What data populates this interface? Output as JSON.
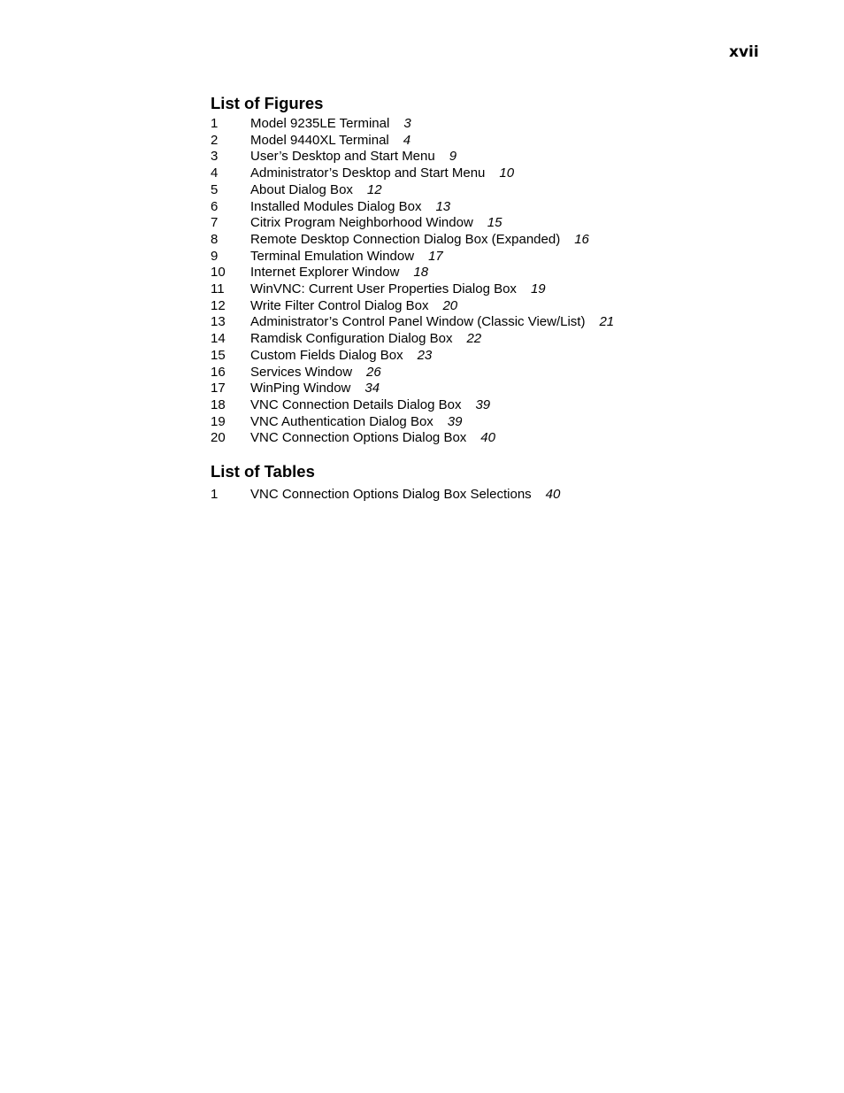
{
  "page": {
    "number": "xvii"
  },
  "figures": {
    "heading": "List of Figures",
    "items": [
      {
        "num": "1",
        "title": "Model 9235LE Terminal",
        "page": "3"
      },
      {
        "num": "2",
        "title": "Model 9440XL Terminal",
        "page": "4"
      },
      {
        "num": "3",
        "title": "User’s Desktop and Start Menu",
        "page": "9"
      },
      {
        "num": "4",
        "title": "Administrator’s Desktop and Start Menu",
        "page": "10"
      },
      {
        "num": "5",
        "title": "About Dialog Box",
        "page": "12"
      },
      {
        "num": "6",
        "title": "Installed Modules Dialog Box",
        "page": "13"
      },
      {
        "num": "7",
        "title": "Citrix Program Neighborhood Window",
        "page": "15"
      },
      {
        "num": "8",
        "title": "Remote Desktop Connection Dialog Box (Expanded)",
        "page": "16"
      },
      {
        "num": "9",
        "title": "Terminal Emulation Window",
        "page": "17"
      },
      {
        "num": "10",
        "title": "Internet Explorer Window",
        "page": "18"
      },
      {
        "num": "11",
        "title": "WinVNC: Current User Properties Dialog Box",
        "page": "19"
      },
      {
        "num": "12",
        "title": "Write Filter Control Dialog Box",
        "page": "20"
      },
      {
        "num": "13",
        "title": "Administrator’s Control Panel Window (Classic View/List)",
        "page": "21"
      },
      {
        "num": "14",
        "title": "Ramdisk Configuration Dialog Box",
        "page": "22"
      },
      {
        "num": "15",
        "title": "Custom Fields Dialog Box",
        "page": "23"
      },
      {
        "num": "16",
        "title": "Services Window",
        "page": "26"
      },
      {
        "num": "17",
        "title": "WinPing Window",
        "page": "34"
      },
      {
        "num": "18",
        "title": "VNC Connection Details Dialog Box",
        "page": "39"
      },
      {
        "num": "19",
        "title": "VNC Authentication Dialog Box",
        "page": "39"
      },
      {
        "num": "20",
        "title": "VNC Connection Options Dialog Box",
        "page": "40"
      }
    ]
  },
  "tables": {
    "heading": "List of Tables",
    "items": [
      {
        "num": "1",
        "title": "VNC Connection Options Dialog Box Selections",
        "page": "40"
      }
    ]
  }
}
